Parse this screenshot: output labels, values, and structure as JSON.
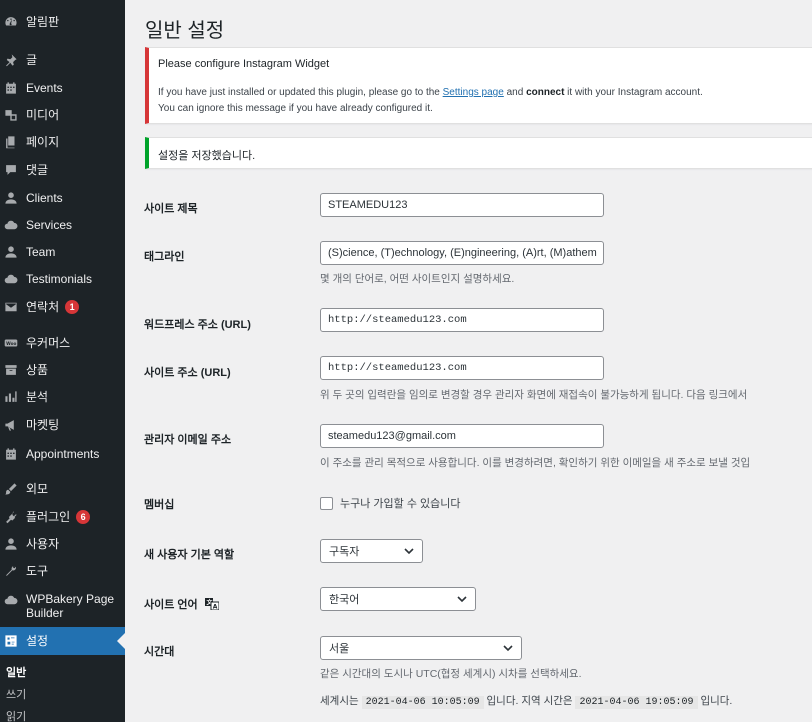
{
  "sidebar": {
    "dashboard": "알림판",
    "posts": "글",
    "events": "Events",
    "media": "미디어",
    "pages": "페이지",
    "comments": "댓글",
    "clients": "Clients",
    "services": "Services",
    "team": "Team",
    "testimonials": "Testimonials",
    "contact": "연락처",
    "contact_badge": "1",
    "woocommerce": "우커머스",
    "products": "상품",
    "analytics": "분석",
    "marketing": "마켓팅",
    "appointments": "Appointments",
    "appearance": "외모",
    "plugins": "플러그인",
    "plugins_badge": "6",
    "users": "사용자",
    "tools": "도구",
    "wpbakery_line1": "WPBakery Page",
    "wpbakery_line2": "Builder",
    "settings": "설정",
    "sub_general": "일반",
    "sub_writing": "쓰기",
    "sub_reading": "읽기"
  },
  "page": {
    "title": "일반 설정"
  },
  "notice_error": {
    "title": "Please configure Instagram Widget",
    "line1_pre": "If you have just installed or updated this plugin, please go to the ",
    "line1_link": "Settings page",
    "line1_mid": " and ",
    "line1_bold": "connect",
    "line1_post": " it with your Instagram account.",
    "line2": "You can ignore this message if you have already configured it."
  },
  "notice_success": {
    "text": "설정을 저장했습니다."
  },
  "form": {
    "site_title_label": "사이트 제목",
    "site_title_value": "STEAMEDU123",
    "tagline_label": "태그라인",
    "tagline_value": "(S)cience, (T)echnology, (E)ngineering, (A)rt, (M)athem",
    "tagline_desc": "몇 개의 단어로, 어떤 사이트인지 설명하세요.",
    "wp_url_label": "워드프레스 주소 (URL)",
    "wp_url_value": "http://steamedu123.com",
    "site_url_label": "사이트 주소 (URL)",
    "site_url_value": "http://steamedu123.com",
    "site_url_desc": "위 두 곳의 입력란을 임의로 변경할 경우 관리자 화면에 재접속이 불가능하게 됩니다. 다음 링크에서",
    "admin_email_label": "관리자 이메일 주소",
    "admin_email_value": "steamedu123@gmail.com",
    "admin_email_desc": "이 주소를 관리 목적으로 사용합니다. 이를 변경하려면, 확인하기 위한 이메일을 새 주소로 보낼 것입",
    "membership_label": "멤버십",
    "membership_checkbox": "누구나 가입할 수 있습니다",
    "default_role_label": "새 사용자 기본 역할",
    "default_role_value": "구독자",
    "site_language_label": "사이트 언어",
    "site_language_value": "한국어",
    "timezone_label": "시간대",
    "timezone_value": "서울",
    "timezone_desc": "같은 시간대의 도시나 UTC(협정 세계시) 시차를 선택하세요.",
    "utc_pre": "세계시는",
    "utc_time": "2021-04-06 10:05:09",
    "utc_mid": "입니다. 지역 시간은",
    "local_time": "2021-04-06 19:05:09",
    "utc_post": "입니다."
  },
  "colors": {
    "sidebar_bg": "#1d2327",
    "active_bg": "#2271b1",
    "error": "#d63638",
    "success": "#00a32a",
    "link": "#2271b1"
  }
}
